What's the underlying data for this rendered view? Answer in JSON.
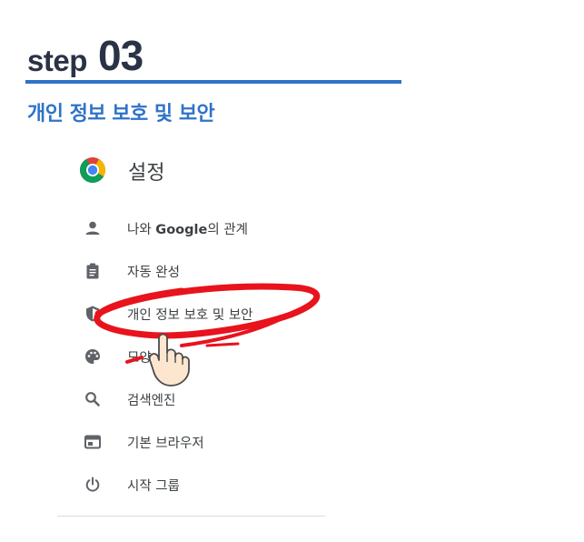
{
  "step": {
    "word": "step",
    "number": "03"
  },
  "section_title": "개인 정보 보호 및 보안",
  "settings": {
    "title": "설정",
    "items": [
      {
        "pre": "나와 ",
        "bold": "Google",
        "post": "의 관계",
        "icon": "person-icon"
      },
      {
        "label": "자동 완성",
        "icon": "clipboard-icon"
      },
      {
        "label": "개인 정보 보호 및 보안",
        "icon": "shield-icon",
        "highlighted": true
      },
      {
        "label": "모양",
        "icon": "palette-icon"
      },
      {
        "label": "검색엔진",
        "icon": "search-icon"
      },
      {
        "label": "기본 브라우저",
        "icon": "browser-window-icon"
      },
      {
        "label": "시작 그룹",
        "icon": "power-icon"
      }
    ]
  },
  "colors": {
    "accent": "#2f73c9",
    "heading": "#2a3346",
    "highlight": "#e8131c",
    "icon": "#5f6368"
  }
}
